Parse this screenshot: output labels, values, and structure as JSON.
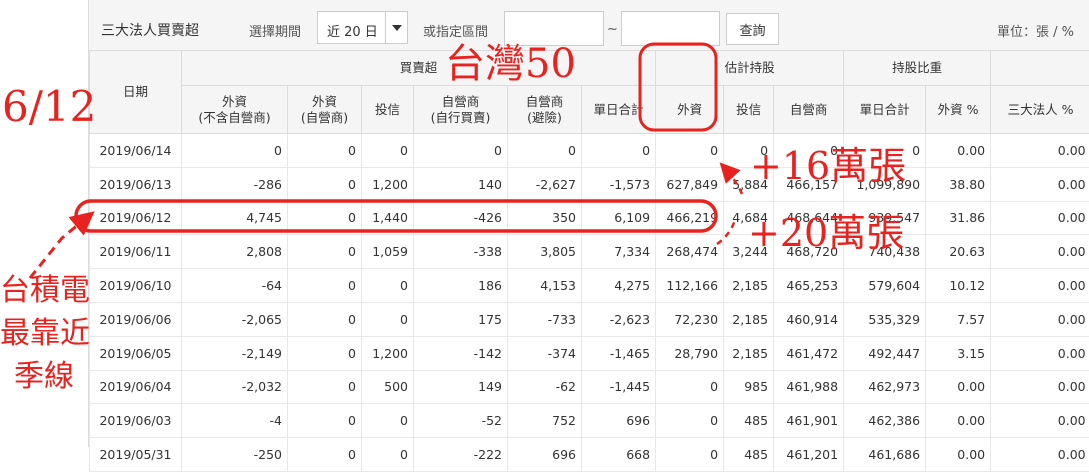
{
  "toolbar": {
    "title": "三大法人買賣超",
    "period_label": "選擇期間",
    "period_value": "近 20 日",
    "range_label": "或指定區間",
    "range_sep": "~",
    "query_label": "查詢",
    "unit_label": "單位：張 / %"
  },
  "header": {
    "date": "日期",
    "group_trade": "買賣超",
    "group_est": "估計持股",
    "group_ratio": "持股比重",
    "cols": [
      [
        "外資",
        "(不含自營商)"
      ],
      [
        "外資",
        "(自營商)"
      ],
      [
        "投信"
      ],
      [
        "自營商",
        "(自行買賣)"
      ],
      [
        "自營商",
        "(避險)"
      ],
      [
        "單日合計"
      ],
      [
        "外資"
      ],
      [
        "投信"
      ],
      [
        "自營商"
      ],
      [
        "單日合計"
      ],
      [
        "外資 %"
      ],
      [
        "三大法人 %"
      ]
    ]
  },
  "rows": [
    [
      "2019/06/14",
      "0",
      "0",
      "0",
      "0",
      "0",
      "0",
      "0",
      "0",
      "0",
      "0",
      "0.00",
      "0.00"
    ],
    [
      "2019/06/13",
      "-286",
      "0",
      "1,200",
      "140",
      "-2,627",
      "-1,573",
      "627,849",
      "5,884",
      "466,157",
      "1,099,890",
      "38.80",
      "0.00"
    ],
    [
      "2019/06/12",
      "4,745",
      "0",
      "1,440",
      "-426",
      "350",
      "6,109",
      "466,219",
      "4,684",
      "468,644",
      "939,547",
      "31.86",
      "0.00"
    ],
    [
      "2019/06/11",
      "2,808",
      "0",
      "1,059",
      "-338",
      "3,805",
      "7,334",
      "268,474",
      "3,244",
      "468,720",
      "740,438",
      "20.63",
      "0.00"
    ],
    [
      "2019/06/10",
      "-64",
      "0",
      "0",
      "186",
      "4,153",
      "4,275",
      "112,166",
      "2,185",
      "465,253",
      "579,604",
      "10.12",
      "0.00"
    ],
    [
      "2019/06/06",
      "-2,065",
      "0",
      "0",
      "175",
      "-733",
      "-2,623",
      "72,230",
      "2,185",
      "460,914",
      "535,329",
      "7.57",
      "0.00"
    ],
    [
      "2019/06/05",
      "-2,149",
      "0",
      "1,200",
      "-142",
      "-374",
      "-1,465",
      "28,790",
      "2,185",
      "461,472",
      "492,447",
      "3.15",
      "0.00"
    ],
    [
      "2019/06/04",
      "-2,032",
      "0",
      "500",
      "149",
      "-62",
      "-1,445",
      "0",
      "985",
      "461,988",
      "462,973",
      "0.00",
      "0.00"
    ],
    [
      "2019/06/03",
      "-4",
      "0",
      "0",
      "-52",
      "752",
      "696",
      "0",
      "485",
      "461,901",
      "462,386",
      "0.00",
      "0.00"
    ],
    [
      "2019/05/31",
      "-250",
      "0",
      "0",
      "-222",
      "696",
      "668",
      "0",
      "485",
      "461,201",
      "461,686",
      "0.00",
      "0.00"
    ]
  ],
  "annotations": {
    "date_note": "6/12",
    "etf_note": "台灣50",
    "plus16": "+16萬張",
    "plus20": "+20萬張",
    "tsmc_note": [
      "台積電",
      "最靠近",
      "季線"
    ],
    "color": "#e8221e"
  },
  "colors": {
    "positive": "#d4282d",
    "negative": "#22a03a"
  }
}
